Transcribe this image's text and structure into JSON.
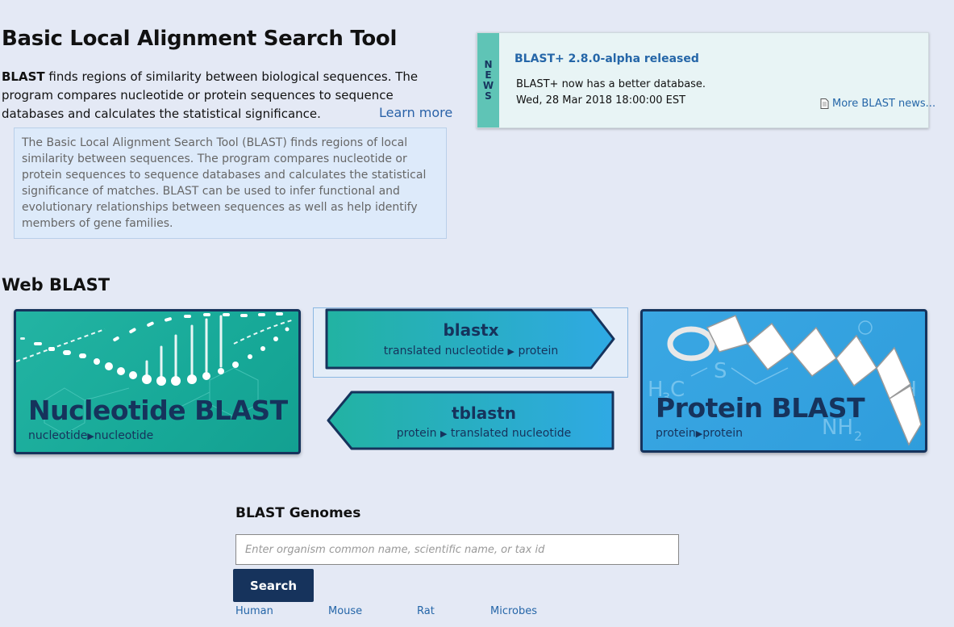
{
  "header": {
    "title": "Basic Local Alignment Search Tool",
    "intro_bold": "BLAST",
    "intro_rest": " finds regions of similarity between biological sequences. The program compares nucleotide or protein sequences to sequence databases and calculates the statistical significance.",
    "learn_more": "Learn more",
    "description": "The Basic Local Alignment Search Tool (BLAST) finds regions of local similarity between sequences. The program compares nucleotide or protein sequences to sequence databases and calculates the statistical significance of matches. BLAST can be used to infer functional and evolutionary relationships between sequences as well as help identify members of gene families."
  },
  "news": {
    "tab_letters": [
      "N",
      "E",
      "W",
      "S"
    ],
    "headline": "BLAST+ 2.8.0-alpha released",
    "body_line1": "BLAST+ now has a better database.",
    "body_line2": "Wed, 28 Mar 2018 18:00:00 EST",
    "more_link": "More BLAST news...",
    "icon": "document-icon"
  },
  "web_blast": {
    "title": "Web BLAST",
    "nucleotide": {
      "title": "Nucleotide BLAST",
      "from": "nucleotide",
      "to": "nucleotide"
    },
    "protein": {
      "title": "Protein BLAST",
      "from": "protein",
      "to": "protein"
    },
    "blastx": {
      "name": "blastx",
      "from": "translated nucleotide",
      "to": "protein"
    },
    "tblastn": {
      "name": "tblastn",
      "from": "protein",
      "to": "translated nucleotide"
    },
    "arrow_glyph": "▶",
    "colors": {
      "navy": "#16335c",
      "teal": "#1db0a0",
      "blue": "#2fa5e0"
    }
  },
  "genomes": {
    "title": "BLAST Genomes",
    "placeholder": "Enter organism common name, scientific name, or tax id",
    "search_label": "Search",
    "links": [
      "Human",
      "Mouse",
      "Rat",
      "Microbes"
    ]
  }
}
